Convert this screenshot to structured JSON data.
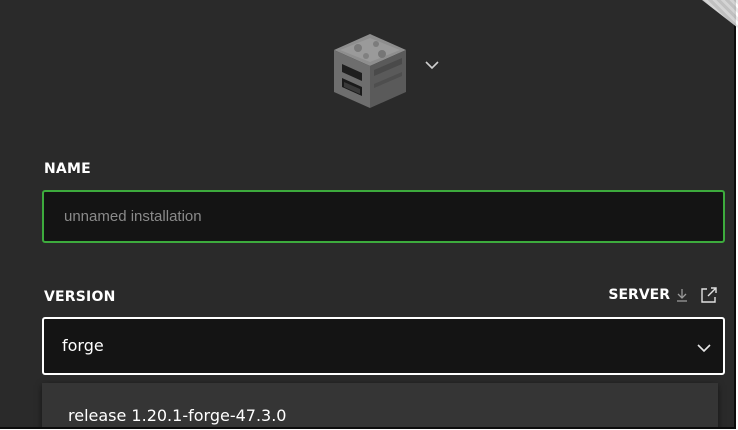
{
  "installation": {
    "icon": "furnace-block-icon",
    "icon_dropdown": "chevron-down-icon"
  },
  "name": {
    "label": "NAME",
    "value": "",
    "placeholder": "unnamed installation"
  },
  "version": {
    "label": "VERSION",
    "selected": "forge",
    "server_label": "SERVER",
    "server_icons": [
      "download-icon",
      "external-link-icon"
    ],
    "options": [
      "release 1.20.1-forge-47.3.0"
    ]
  },
  "colors": {
    "background": "#2a2a2a",
    "input_bg": "#141414",
    "focus_green": "#3dab3d",
    "text": "#ffffff",
    "placeholder": "#8a8a8a",
    "dropdown_bg": "#353535"
  }
}
